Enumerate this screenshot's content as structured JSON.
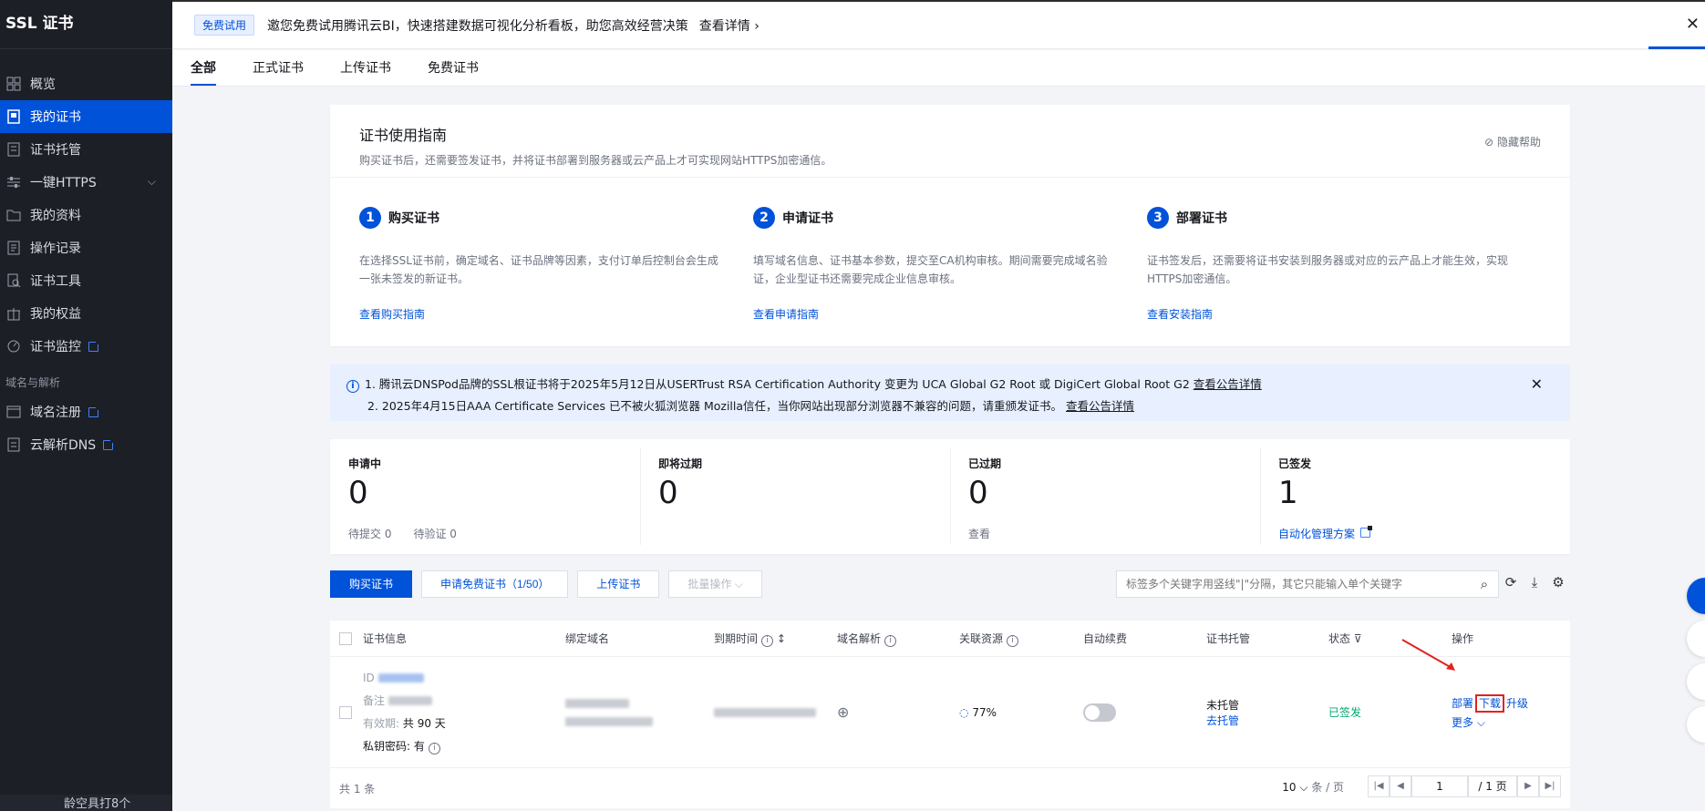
{
  "sidebar": {
    "title": "SSL 证书",
    "items": [
      {
        "label": "概览",
        "icon": "grid-icon"
      },
      {
        "label": "我的证书",
        "icon": "certificate-icon",
        "active": true
      },
      {
        "label": "证书托管",
        "icon": "hosting-icon"
      },
      {
        "label": "一键HTTPS",
        "icon": "sliders-icon",
        "has_children": true
      },
      {
        "label": "我的资料",
        "icon": "folder-icon"
      },
      {
        "label": "操作记录",
        "icon": "log-icon"
      },
      {
        "label": "证书工具",
        "icon": "tool-icon"
      },
      {
        "label": "我的权益",
        "icon": "gift-icon"
      },
      {
        "label": "证书监控",
        "icon": "monitor-icon",
        "external": true
      }
    ],
    "group_label": "域名与解析",
    "group_items": [
      {
        "label": "域名注册",
        "icon": "domain-icon",
        "external": true
      },
      {
        "label": "云解析DNS",
        "icon": "dns-icon",
        "external": true
      }
    ],
    "bottom_text": "龄空具打8个"
  },
  "topbar": {
    "badge": "免费试用",
    "text": "邀您免费试用腾讯云BI，快速搭建数据可视化分析看板，助您高效经营决策",
    "link": "查看详情 ›"
  },
  "tabs": [
    "全部",
    "正式证书",
    "上传证书",
    "免费证书"
  ],
  "guide": {
    "title": "证书使用指南",
    "subtitle": "购买证书后，还需要签发证书，并将证书部署到服务器或云产品上才可实现网站HTTPS加密通信。",
    "hide_help": "隐藏帮助",
    "steps": [
      {
        "num": "1",
        "title": "购买证书",
        "desc": "在选择SSL证书前，确定域名、证书品牌等因素，支付订单后控制台会生成一张未签发的新证书。",
        "link": "查看购买指南"
      },
      {
        "num": "2",
        "title": "申请证书",
        "desc": "填写域名信息、证书基本参数，提交至CA机构审核。期间需要完成域名验证，企业型证书还需要完成企业信息审核。",
        "link": "查看申请指南"
      },
      {
        "num": "3",
        "title": "部署证书",
        "desc": "证书签发后，还需要将证书安装到服务器或对应的云产品上才能生效，实现HTTPS加密通信。",
        "link": "查看安装指南"
      }
    ]
  },
  "notice": {
    "line1": "1. 腾讯云DNSPod品牌的SSL根证书将于2025年5月12日从USERTrust RSA Certification Authority 变更为 UCA Global G2 Root 或 DigiCert Global Root G2",
    "line1_link": "查看公告详情",
    "line2": "2. 2025年4月15日AAA Certificate Services 已不被火狐浏览器 Mozilla信任，当你网站出现部分浏览器不兼容的问题，请重颁发证书。",
    "line2_link": "查看公告详情"
  },
  "stats": [
    {
      "label": "申请中",
      "value": "0",
      "sub1": "待提交 0",
      "sub2": "待验证 0"
    },
    {
      "label": "即将过期",
      "value": "0",
      "sub1": "",
      "sub2": ""
    },
    {
      "label": "已过期",
      "value": "0",
      "sub1": "查看",
      "sub2": ""
    },
    {
      "label": "已签发",
      "value": "1",
      "link": "自动化管理方案"
    }
  ],
  "toolbar": {
    "buy": "购买证书",
    "apply_free": "申请免费证书（1/50）",
    "upload": "上传证书",
    "batch": "批量操作",
    "search_placeholder": "标签多个关键字用竖线\"|\"分隔，其它只能输入单个关键字"
  },
  "table": {
    "headers": [
      "证书信息",
      "绑定域名",
      "到期时间",
      "域名解析",
      "关联资源",
      "自动续费",
      "证书托管",
      "状态",
      "操作"
    ],
    "row": {
      "id_label": "ID",
      "remark_label": "备注",
      "validity_label": "有效期:",
      "validity_value": "共 90 天",
      "private_key_label": "私钥密码:",
      "private_key_value": "有",
      "resource_progress": "77%",
      "hosting_status": "未托管",
      "hosting_link": "去托管",
      "status": "已签发",
      "ops": [
        "部署",
        "下载",
        "升级"
      ],
      "more": "更多"
    }
  },
  "footer": {
    "total": "共 1 条",
    "page_size": "10",
    "page_size_unit": "条 / 页",
    "page": "1",
    "page_total": "/ 1 页"
  }
}
